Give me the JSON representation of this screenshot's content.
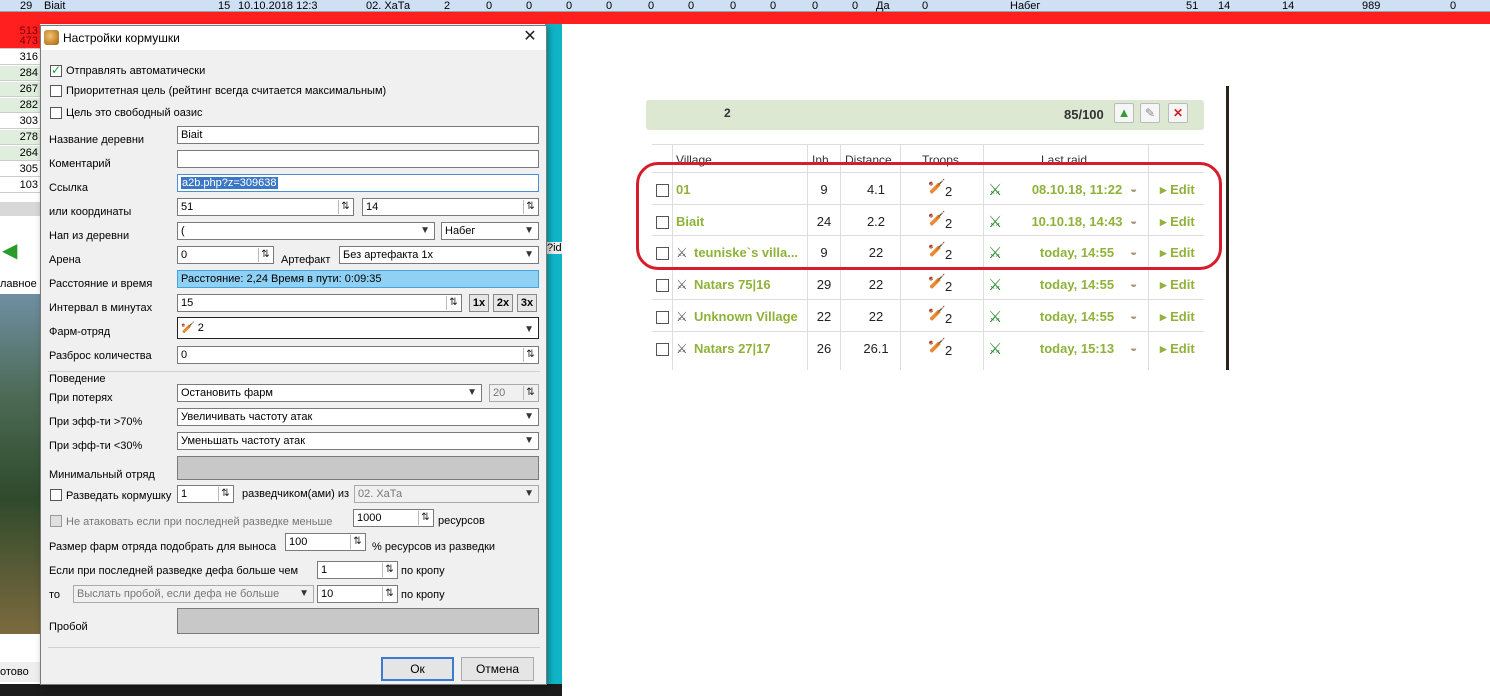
{
  "background": {
    "top_row": {
      "c1": "29",
      "c2": "Biait",
      "c3": "15",
      "c4": "10.10.2018 12:3",
      "c5": "02. ХаТа",
      "c6": "2",
      "c7": "0",
      "c8": "0",
      "c9": "0",
      "c10": "0",
      "c11": "0",
      "c12": "0",
      "c13": "0",
      "c14": "0",
      "c15": "0",
      "c16": "0",
      "c17": "Да",
      "c18": "0",
      "c19": "Набег",
      "c20": "51",
      "c21": "14",
      "c22": "14",
      "c23": "989",
      "c24": "0"
    },
    "left_cells": [
      "513",
      "473",
      "316",
      "284",
      "267",
      "282",
      "303",
      "278",
      "264",
      "305",
      "103"
    ],
    "glavnoe": "лавное",
    "gotovo": "отово",
    "id_label": "?id"
  },
  "dialog": {
    "title": "Настройки кормушки",
    "send_auto": "Отправлять автоматически",
    "priority": "Приоритетная цель (рейтинг всегда считается максимальным)",
    "free_oasis": "Цель это свободный оазис",
    "village_name_label": "Название деревни",
    "village_name": "Biait",
    "comment_label": "Коментарий",
    "comment": "",
    "link_label": "Ссылка",
    "link": "a2b.php?z=309638",
    "coords_label": "или координаты",
    "coord_x": "51",
    "coord_y": "14",
    "from_village_label": "Нап из деревни",
    "from_village": "(",
    "attack_type": "Набег",
    "arena_label": "Арена",
    "arena": "0",
    "artifact_label": "Артефакт",
    "artifact": "Без артефакта 1x",
    "distance_label": "Расстояние и время",
    "distance": "Расстояние: 2,24 Время в пути: 0:09:35",
    "interval_label": "Интервал в минутах",
    "interval": "15",
    "mult1": "1x",
    "mult2": "2x",
    "mult3": "3x",
    "farm_squad_label": "Фарм-отряд",
    "farm_squad": "2",
    "spread_label": "Разброс количества",
    "spread": "0",
    "behavior_label": "Поведение",
    "losses_label": "При потерях",
    "losses": "Остановить фарм",
    "losses_pct": "20",
    "eff_high_label": "При эфф-ти >70%",
    "eff_high": "Увеличивать частоту атак",
    "eff_low_label": "При эфф-ти <30%",
    "eff_low": "Уменьшать частоту атак",
    "min_squad_label": "Минимальный отряд",
    "scout_label": "Разведать кормушку",
    "scout_count": "1",
    "scout_mid": "разведчиком(ами) из",
    "scout_from": "02. ХаТа",
    "no_attack_label": "Не атаковать если при последней разведке меньше",
    "no_attack_val": "1000",
    "resources": "ресурсов",
    "size_label": "Размер фарм отряда подобрать для выноса",
    "size_val": "100",
    "size_suffix": "% ресурсов из разведки",
    "def_label": "Если при последней разведке дефа больше чем",
    "def_val": "1",
    "per_crop": "по кропу",
    "then_label": "то",
    "then_val": "Выслать пробой, если дефа не больше",
    "then_num": "10",
    "per_crop2": "по кропу",
    "probe_label": "Пробой",
    "ok": "Ок",
    "cancel": "Отмена"
  },
  "farm_list": {
    "count": "2",
    "capacity": "85/100",
    "headers": {
      "village": "Village",
      "inh": "Inh",
      "distance": "Distance",
      "troops": "Troops",
      "last_raid": "Last raid"
    },
    "rows": [
      {
        "village": "01",
        "inh": "9",
        "distance": "4.1",
        "troops": "2",
        "last_raid": "08.10.18, 11:22",
        "edit": "Edit",
        "attacked": false
      },
      {
        "village": "Biait",
        "inh": "24",
        "distance": "2.2",
        "troops": "2",
        "last_raid": "10.10.18, 14:43",
        "edit": "Edit",
        "attacked": false
      },
      {
        "village": "teuniske`s villa...",
        "inh": "9",
        "distance": "22",
        "troops": "2",
        "last_raid": "today, 14:55",
        "edit": "Edit",
        "attacked": true
      },
      {
        "village": "Natars 75|16",
        "inh": "29",
        "distance": "22",
        "troops": "2",
        "last_raid": "today, 14:55",
        "edit": "Edit",
        "attacked": true
      },
      {
        "village": "Unknown Village",
        "inh": "22",
        "distance": "22",
        "troops": "2",
        "last_raid": "today, 14:55",
        "edit": "Edit",
        "attacked": true
      },
      {
        "village": "Natars 27|17",
        "inh": "26",
        "distance": "26.1",
        "troops": "2",
        "last_raid": "today, 15:13",
        "edit": "Edit",
        "attacked": true
      }
    ]
  }
}
